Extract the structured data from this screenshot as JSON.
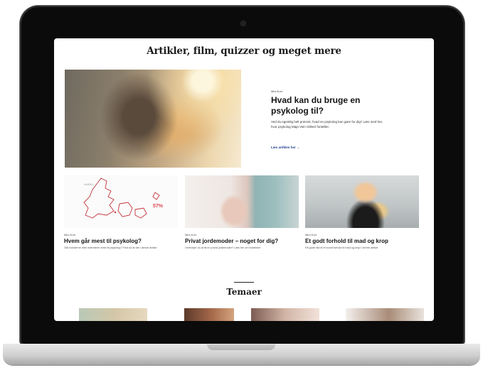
{
  "page": {
    "section_heading": "Artikler, film, quizzer og meget mere",
    "hero": {
      "kicker": "Mini-Kort",
      "title": "Hvad kan du bruge en psykolog til?",
      "text": "Ved du egentlig helt præcist, hvad en psykolog kan gøre for dig? Læs med her, hvor psykolog Maja Vein Gilbert fortæller.",
      "link": "Læs artiklen her →"
    },
    "cards": [
      {
        "kicker": "Mini-Kort",
        "title": "Hvem går mest til psykolog?",
        "text": "Går kvinderne eller mændene mest til psykolog? Find ud af det i denne artikel",
        "image": {
          "map_label": "ANDEL",
          "percent": "57%"
        }
      },
      {
        "kicker": "Mini-Kort",
        "title": "Privat jordemoder – noget for dig?",
        "text": "Overvejer du at få en privat jordemoder? Læs her om fordelene"
      },
      {
        "kicker": "Mini-Kort",
        "title": "Et godt forhold til mad og krop",
        "text": "Få gode råd til et sundt forhold til mad og krop i denne artikel"
      }
    ],
    "temaer_heading": "Temaer"
  },
  "colors": {
    "screen_bg": "#ffffff",
    "laptop_bezel": "#0b0b0b",
    "laptop_base": "#d5d5d5",
    "link": "#1f3d8c",
    "map_accent": "#e04a53"
  },
  "icons": {
    "camera": "camera-dot",
    "link_arrow": "arrow-right-icon"
  }
}
